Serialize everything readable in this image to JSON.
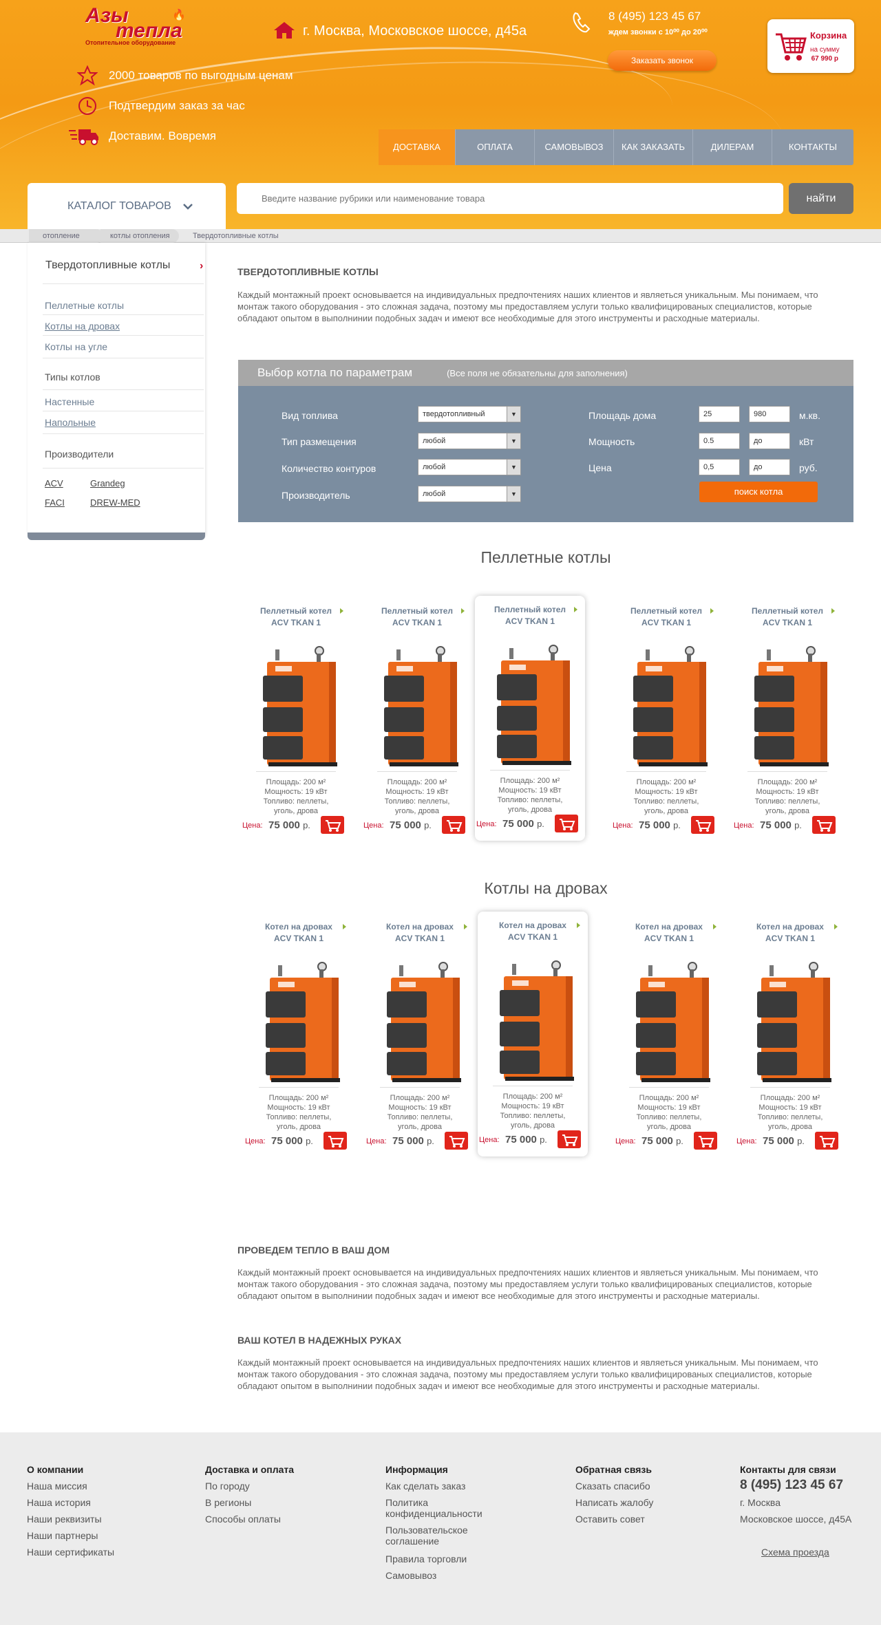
{
  "header": {
    "logo_line1": "Азы",
    "logo_line2": "тепла",
    "logo_sub": "Отопительное оборудование",
    "address": "г. Москва, Московское шоссе, д45а",
    "phone": "8 (495) 123 45 67",
    "phone_hours": "ждем звонки с 10⁰⁰ до 20⁰⁰",
    "callback_label": "Заказать звонок",
    "cart_title": "Корзина",
    "cart_sum_label": "на сумму",
    "cart_sum": "67 990 р",
    "features": [
      "2000 товаров по выгодным ценам",
      "Подтвердим заказ за час",
      "Доставим. Вовремя"
    ]
  },
  "nav": {
    "items": [
      "ДОСТАВКА",
      "ОПЛАТА",
      "САМОВЫВОЗ",
      "КАК ЗАКАЗАТЬ",
      "ДИЛЕРАМ",
      "КОНТАКТЫ"
    ],
    "active_index": 0
  },
  "catalog_label": "КАТАЛОГ ТОВАРОВ",
  "search": {
    "placeholder": "Введите название рубрики или наименование товара",
    "button": "найти"
  },
  "breadcrumb": [
    "отопление",
    "котлы отопления",
    "Твердотопливные котлы"
  ],
  "sidebar": {
    "title": "Твердотопливные котлы",
    "links": [
      "Пеллетные котлы",
      "Котлы на дровах",
      "Котлы на угле"
    ],
    "types_heading": "Типы котлов",
    "types": [
      "Настенные",
      "Напольные"
    ],
    "makers_heading": "Производители",
    "makers": [
      "ACV",
      "Grandeg",
      "FACI",
      "DREW-MED"
    ]
  },
  "intro": {
    "heading": "ТВЕРДОТОПЛИВНЫЕ КОТЛЫ",
    "text": "Каждый монтажный проект основывается на индивидуальных предпочтениях наших клиентов и являеться уникальным. Мы понимаем, что монтаж такого оборудования - это сложная задача, поэтому мы предоставляем услуги только квалифицированых специалистов, которые обладают опытом в выполнинии подобных задач и имеют все необходимые для этого инструменты   и расходные материалы."
  },
  "filter": {
    "title": "Выбор котла по параметрам",
    "hint": "(Все поля не обязательны для заполнения)",
    "fuel_label": "Вид топлива",
    "fuel_value": "твердотопливный",
    "placement_label": "Тип размещения",
    "placement_value": "любой",
    "circuits_label": "Количество контуров",
    "circuits_value": "любой",
    "maker_label": "Производитель",
    "maker_value": "любой",
    "area_label": "Площадь дома",
    "area_from": "25",
    "area_to": "980",
    "area_unit": "м.кв.",
    "power_label": "Мощность",
    "power_from": "0.5",
    "power_to": "до",
    "power_unit": "кВт",
    "price_label": "Цена",
    "price_from": "0,5",
    "price_to": "до",
    "price_unit": "руб.",
    "button": "поиск котла"
  },
  "pellet": {
    "title": "Пеллетные котлы",
    "items": [
      {
        "name1": "Пеллетный котел",
        "name2": "ACV TKAN 1",
        "area": "Площадь: 200 м²",
        "power": "Мощность: 19 кВт",
        "fuel": "Топливо:   пеллеты,",
        "fuel2": "уголь, дрова",
        "price_label": "Цена:",
        "price": "75 000",
        "cur": "р."
      },
      {
        "name1": "Пеллетный котел",
        "name2": "ACV TKAN 1",
        "area": "Площадь: 200 м²",
        "power": "Мощность: 19 кВт",
        "fuel": "Топливо:   пеллеты,",
        "fuel2": "уголь, дрова",
        "price_label": "Цена:",
        "price": "75 000",
        "cur": "р."
      },
      {
        "name1": "Пеллетный котел",
        "name2": "ACV TKAN 1",
        "area": "Площадь: 200 м²",
        "power": "Мощность: 19 кВт",
        "fuel": "Топливо:   пеллеты,",
        "fuel2": "уголь, дрова",
        "price_label": "Цена:",
        "price": "75 000",
        "cur": "р."
      },
      {
        "name1": "Пеллетный котел",
        "name2": "ACV TKAN 1",
        "area": "Площадь: 200 м²",
        "power": "Мощность: 19 кВт",
        "fuel": "Топливо:   пеллеты,",
        "fuel2": "уголь, дрова",
        "price_label": "Цена:",
        "price": "75 000",
        "cur": "р."
      },
      {
        "name1": "Пеллетный котел",
        "name2": "ACV TKAN 1",
        "area": "Площадь: 200 м²",
        "power": "Мощность: 19 кВт",
        "fuel": "Топливо:   пеллеты,",
        "fuel2": "уголь, дрова",
        "price_label": "Цена:",
        "price": "75 000",
        "cur": "р."
      }
    ]
  },
  "wood": {
    "title": "Котлы на дровах",
    "items": [
      {
        "name1": "Котел на дровах",
        "name2": "ACV TKAN 1",
        "area": "Площадь: 200 м²",
        "power": "Мощность: 19 кВт",
        "fuel": "Топливо:   пеллеты,",
        "fuel2": "уголь, дрова",
        "price_label": "Цена:",
        "price": "75 000",
        "cur": "р."
      },
      {
        "name1": "Котел на дровах",
        "name2": "ACV TKAN 1",
        "area": "Площадь: 200 м²",
        "power": "Мощность: 19 кВт",
        "fuel": "Топливо:   пеллеты,",
        "fuel2": "уголь, дрова",
        "price_label": "Цена:",
        "price": "75 000",
        "cur": "р."
      },
      {
        "name1": "Котел на дровах",
        "name2": "ACV TKAN 1",
        "area": "Площадь: 200 м²",
        "power": "Мощность: 19 кВт",
        "fuel": "Топливо:   пеллеты,",
        "fuel2": "уголь, дрова",
        "price_label": "Цена:",
        "price": "75 000",
        "cur": "р."
      },
      {
        "name1": "Котел на дровах",
        "name2": "ACV TKAN 1",
        "area": "Площадь: 200 м²",
        "power": "Мощность: 19 кВт",
        "fuel": "Топливо:   пеллеты,",
        "fuel2": "уголь, дрова",
        "price_label": "Цена:",
        "price": "75 000",
        "cur": "р."
      },
      {
        "name1": "Котел на дровах",
        "name2": "ACV TKAN 1",
        "area": "Площадь: 200 м²",
        "power": "Мощность: 19 кВт",
        "fuel": "Топливо:   пеллеты,",
        "fuel2": "уголь, дрова",
        "price_label": "Цена:",
        "price": "75 000",
        "cur": "р."
      }
    ]
  },
  "block1": {
    "heading": "ПРОВЕДЕМ ТЕПЛО В ВАШ ДОМ",
    "text": "Каждый монтажный проект основывается на индивидуальных предпочтениях наших клиентов и являеться уникальным. Мы понимаем, что монтаж такого оборудования - это сложная задача, поэтому мы предоставляем услуги только квалифицированых специалистов, которые обладают опытом в выполнинии подобных задач и имеют все необходимые для этого инструменты   и расходные материалы."
  },
  "block2": {
    "heading": "ВАШ КОТЕЛ В НАДЕЖНЫХ РУКАХ",
    "text": "Каждый монтажный проект основывается на индивидуальных предпочтениях наших клиентов и являеться уникальным. Мы понимаем, что монтаж такого оборудования - это сложная задача, поэтому мы предоставляем услуги только квалифицированых специалистов, которые обладают опытом в выполнинии подобных задач и имеют все необходимые для этого инструменты   и расходные материалы."
  },
  "footer": {
    "col1": {
      "heading": "О компании",
      "items": [
        "Наша миссия",
        "Наша история",
        "Наши реквизиты",
        "Наши партнеры",
        "Наши сертификаты"
      ]
    },
    "col2": {
      "heading": "Доставка и оплата",
      "items": [
        "По городу",
        "В регионы",
        "Способы оплаты"
      ]
    },
    "col3": {
      "heading": "Информация",
      "items": [
        "Как сделать заказ",
        "Политика конфиденциальности",
        "Пользовательское соглашение",
        "Правила торговли",
        "Самовывоз"
      ]
    },
    "col4": {
      "heading": "Обратная связь",
      "items": [
        "Сказать спасибо",
        "Написать жалобу",
        "Оставить совет"
      ]
    },
    "col5": {
      "heading": "Контакты для связи",
      "phone": "8 (495) 123 45 67",
      "city": "г. Москва",
      "street": "Московское шоссе, д45А",
      "map_link": "Схема проезда"
    }
  },
  "colors": {
    "accent": "#f7941d",
    "brand_red": "#c8102e",
    "nav_bg": "#8b98a8",
    "filter_bg": "#7b8da0"
  }
}
